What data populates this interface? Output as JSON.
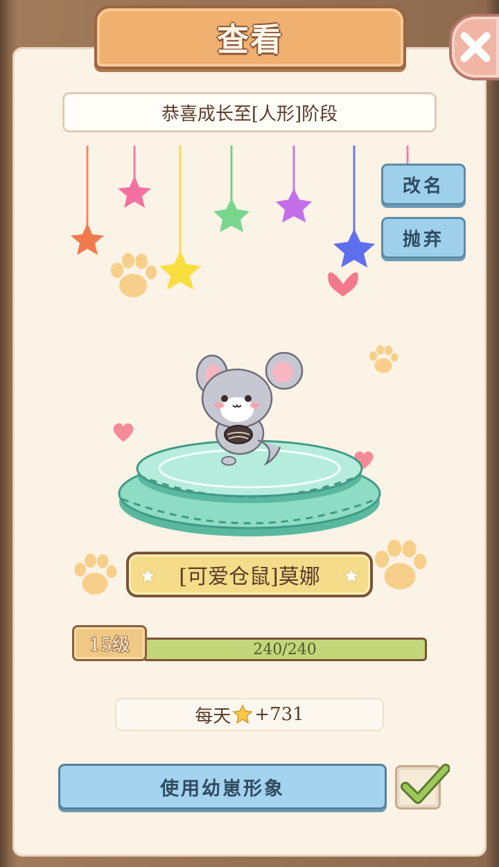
{
  "header": {
    "title": "查看"
  },
  "message": "恭喜成长至[人形]阶段",
  "actions": {
    "rename": "改名",
    "abandon": "抛弃"
  },
  "pet": {
    "name": "[可爱仓鼠]莫娜",
    "level": "15级",
    "xp_text": "240/240",
    "xp_fraction": 1.0
  },
  "daily": {
    "prefix": "每天",
    "icon": "star-coin-icon",
    "amount": "+731"
  },
  "use_image_button": "使用幼崽形象",
  "use_image_checked": true,
  "colors": {
    "panel": "#fbf3e6",
    "title_plate": "#f0b070",
    "blue_button": "#9ed0ec",
    "xp_fill": "#c4d67a",
    "name_plate": "#f5dc8a"
  }
}
